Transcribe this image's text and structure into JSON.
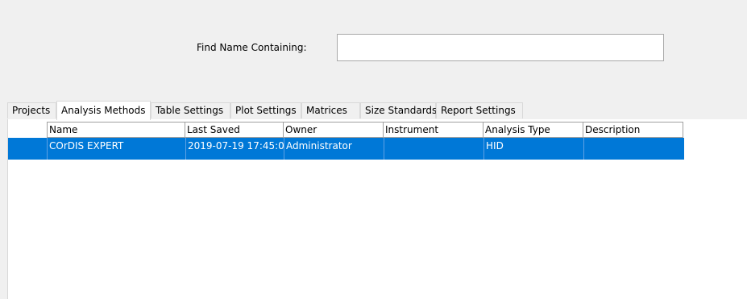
{
  "search": {
    "label": "Find Name Containing:",
    "value": "",
    "placeholder": ""
  },
  "tabs": [
    {
      "label": "Projects",
      "active": false
    },
    {
      "label": "Analysis Methods",
      "active": true
    },
    {
      "label": "Table Settings",
      "active": false
    },
    {
      "label": "Plot Settings",
      "active": false
    },
    {
      "label": "Matrices",
      "active": false
    },
    {
      "label": "Size Standards",
      "active": false
    },
    {
      "label": "Report Settings",
      "active": false
    }
  ],
  "table": {
    "columns": [
      "Name",
      "Last Saved",
      "Owner",
      "Instrument",
      "Analysis Type",
      "Description"
    ],
    "rows": [
      {
        "selected": true,
        "cells": [
          "COrDIS EXPERT",
          "2019-07-19 17:45:0",
          "Administrator",
          "",
          "HID",
          ""
        ]
      }
    ]
  },
  "colors": {
    "background": "#f0f0f0",
    "selection": "#0078d7",
    "selection_text": "#ffffff",
    "border": "#a0a0a0"
  }
}
